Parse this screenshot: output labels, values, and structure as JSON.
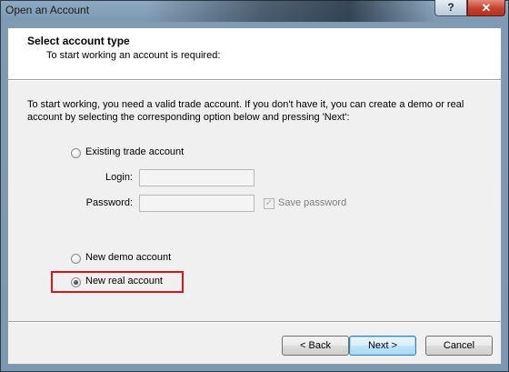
{
  "window": {
    "title": "Open an Account",
    "help_glyph": "?",
    "close_glyph": "✕"
  },
  "header": {
    "title": "Select account type",
    "subtitle": "To start working an account is required:"
  },
  "description": "To start working, you need a valid trade account. If you don't have it, you can create a demo or real account by selecting the corresponding option below and pressing 'Next':",
  "options": {
    "existing": {
      "label": "Existing trade account",
      "selected": false
    },
    "demo": {
      "label": "New demo account",
      "selected": false
    },
    "real": {
      "label": "New real account",
      "selected": true
    }
  },
  "login_form": {
    "login_label": "Login:",
    "login_value": "",
    "password_label": "Password:",
    "password_value": "",
    "save_password_label": "Save password",
    "save_password_checked": true
  },
  "buttons": {
    "back": "< Back",
    "next": "Next >",
    "cancel": "Cancel"
  },
  "colors": {
    "highlight": "#d3161b",
    "close_button": "#c7402b",
    "default_button_border": "#3c7fb1"
  }
}
